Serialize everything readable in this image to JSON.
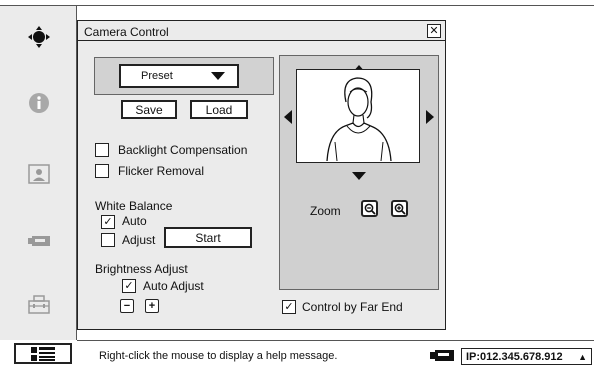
{
  "dialog": {
    "title": "Camera Control",
    "close_symbol": "✕",
    "preset": {
      "selected": "Preset"
    },
    "save_label": "Save",
    "load_label": "Load",
    "backlight_label": "Backlight Compensation",
    "flicker_label": "Flicker Removal",
    "white_balance": {
      "heading": "White Balance",
      "auto_label": "Auto",
      "auto_checked": true,
      "adjust_label": "Adjust",
      "start_label": "Start"
    },
    "brightness": {
      "heading": "Brightness Adjust",
      "auto_adjust_label": "Auto Adjust",
      "auto_adjust_checked": true,
      "minus_label": "−",
      "plus_label": "+"
    },
    "zoom_label": "Zoom",
    "far_end_label": "Control by Far End",
    "far_end_checked": true
  },
  "sidebar": {
    "icons": [
      "move-icon",
      "info-icon",
      "person-icon",
      "camera-icon",
      "network-icon",
      "menu-icon"
    ]
  },
  "status": {
    "help_text": "Right-click the mouse to display a help message.",
    "ip_text": "IP:012.345.678.912",
    "ip_arrow": "▲"
  },
  "check_symbol": "✓"
}
